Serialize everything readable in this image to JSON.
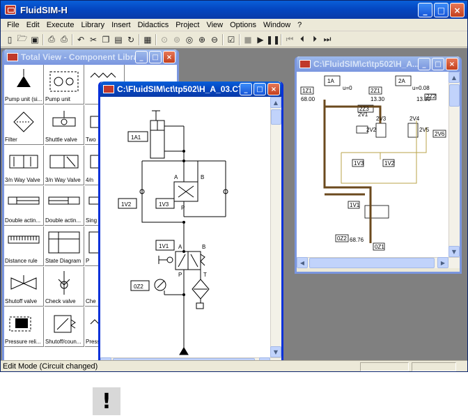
{
  "app": {
    "title": "FluidSIM-H",
    "controls": {
      "minimize": "_",
      "maximize": "□",
      "close": "×"
    }
  },
  "menu": [
    "File",
    "Edit",
    "Execute",
    "Library",
    "Insert",
    "Didactics",
    "Project",
    "View",
    "Options",
    "Window",
    "?"
  ],
  "toolbar": {
    "icons": [
      "new-file-icon",
      "open-file-icon",
      "save-icon",
      "print-preview-icon",
      "print-icon",
      "undo-icon",
      "cut-icon",
      "copy-icon",
      "paste-icon",
      "rotate-icon",
      "grid-icon",
      "zoom-fit-icon",
      "zoom-window-icon",
      "zoom-100-icon",
      "zoom-in-icon",
      "zoom-out-icon",
      "check-icon",
      "stop-icon",
      "play-icon",
      "pause-icon",
      "rewind-icon",
      "step-back-icon",
      "step-forward-icon",
      "fast-forward-icon"
    ]
  },
  "status": {
    "text": "Edit Mode (Circuit changed)"
  },
  "library_window": {
    "title": "Total View - Component Library",
    "items": [
      "Pump unit (si...",
      "Pump unit",
      "",
      "Filter",
      "Shuttle valve",
      "Two",
      "3/n Way Valve",
      "3/n Way Valve",
      "4/n",
      "Double actin...",
      "Double actin...",
      "Sing",
      "Distance rule",
      "State Diagram",
      "P",
      "Shutoff valve",
      "Check valve",
      "Che",
      "Pressure reli...",
      "Shutoff/coun...",
      "Pressure reli..."
    ]
  },
  "circuit_window": {
    "title": "C:\\FluidSIM\\ct\\tp502\\H_A_03.CT",
    "labels": {
      "cylinder": "1A1",
      "valve_1v2": "1V2",
      "valve_1v3": "1V3",
      "valve_1v1": "1V1",
      "gauge": "0Z2",
      "port_a": "A",
      "port_b": "B",
      "port_p": "P",
      "port_t": "T"
    }
  },
  "overview_window": {
    "title": "C:\\FluidSIM\\ct\\tp502\\H_A...",
    "labels": [
      "1A",
      "2A",
      "1Z1",
      "2Z1",
      "2Z2",
      "2Z3",
      "2V2",
      "2V1",
      "2V3",
      "2V4",
      "2V5",
      "2V6",
      "1V3",
      "1V2",
      "1V1",
      "0Z2",
      "0Z1"
    ],
    "values": [
      "68.00",
      "13.30",
      "13.30",
      "u=0",
      "u=0.08",
      "68.76"
    ]
  },
  "colors": {
    "title_active": "#0447c2",
    "title_inactive": "#7a96df",
    "pressure_line": "#6b4a1e",
    "pilot_line": "#b8a34a",
    "workspace": "#808080"
  }
}
